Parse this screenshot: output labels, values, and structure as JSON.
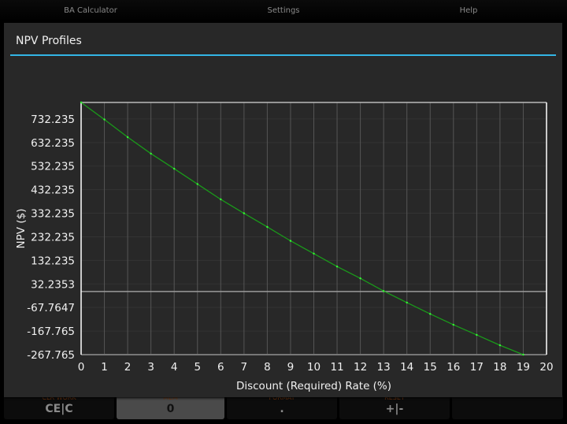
{
  "topbar": {
    "tabs": [
      "BA Calculator",
      "Settings",
      "Help"
    ]
  },
  "keys": [
    {
      "sub": "CLR WORK",
      "main": "CE|C"
    },
    {
      "sub": "MEM",
      "main": "0"
    },
    {
      "sub": "FORMAT",
      "main": "."
    },
    {
      "sub": "RESET",
      "main": "+|-"
    }
  ],
  "dialog": {
    "title": "NPV Profiles"
  },
  "colors": {
    "accent": "#33b5e5",
    "line": "#1a9a1a",
    "background": "#282828"
  },
  "chart_data": {
    "type": "line",
    "title": "NPV Profiles",
    "xlabel": "Discount (Required) Rate (%)",
    "ylabel": "NPV ($)",
    "xlim": [
      0,
      20
    ],
    "ylim": [
      -267.765,
      802.235
    ],
    "xticks": [
      "0",
      "1",
      "2",
      "3",
      "4",
      "5",
      "6",
      "7",
      "8",
      "9",
      "10",
      "11",
      "12",
      "13",
      "14",
      "15",
      "16",
      "17",
      "18",
      "19",
      "20"
    ],
    "yticks": [
      "-267.765",
      "-167.765",
      "-67.7647",
      "32.2353",
      "132.235",
      "232.235",
      "332.235",
      "432.235",
      "532.235",
      "632.235",
      "732.235"
    ],
    "ytick_values": [
      -267.765,
      -167.765,
      -67.7647,
      32.2353,
      132.235,
      232.235,
      332.235,
      432.235,
      532.235,
      632.235,
      732.235
    ],
    "grid": true,
    "series": [
      {
        "name": "NPV",
        "x": [
          0,
          1,
          2,
          3,
          4,
          5,
          6,
          7,
          8,
          9,
          10,
          11,
          12,
          13,
          14,
          15,
          16,
          17,
          18,
          19
        ],
        "y": [
          802.235,
          730,
          655,
          585,
          521,
          456,
          391,
          332,
          274,
          215,
          161,
          106,
          56,
          2,
          -47,
          -95,
          -141,
          -184,
          -228,
          -267.765
        ]
      }
    ]
  }
}
